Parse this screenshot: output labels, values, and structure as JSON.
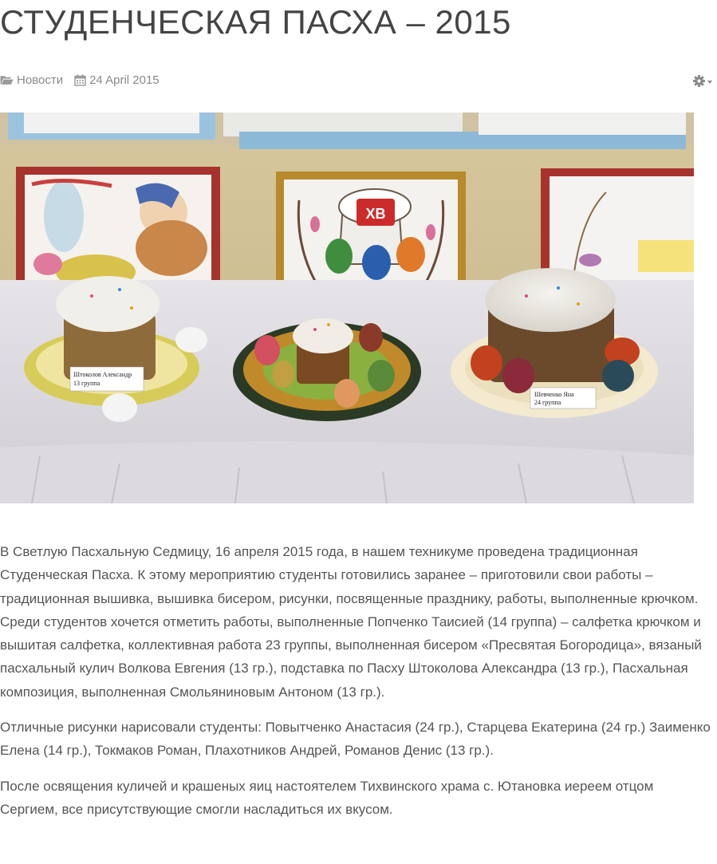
{
  "article": {
    "title": "СТУДЕНЧЕСКАЯ ПАСХА – 2015",
    "category": "Новости",
    "date": "24 April 2015",
    "paragraphs": [
      "В Светлую Пасхальную Седмицу, 16 апреля 2015 года, в нашем техникуме проведена традиционная Студенческая Пасха. К этому мероприятию студенты готовились заранее – приготовили свои работы – традиционная вышивка, вышивка бисером, рисунки, посвященные празднику, работы, выполненные крючком. Среди студентов хочется отметить работы, выполненные Попченко Таисией (14 группа) – салфетка крючком и вышитая салфетка, коллективная работа 23 группы, выполненная бисером «Пресвятая Богородица», вязаный пасхальный кулич Волкова Евгения (13 гр.), подставка по Пасху Штоколова Александра (13 гр.), Пасхальная композиция, выполненная Смольяниновым Антоном (13 гр.).",
      "Отличные рисунки нарисовали студенты: Повытченко Анастасия (24 гр.), Старцева Екатерина (24 гр.) Заименко Елена (14 гр.), Токмаков Роман, Плахотников Андрей, Романов Денис (13 гр.).",
      "После освящения куличей и крашеных яиц настоятелем Тихвинского храма с. Ютановка иереем отцом Сергием, все присутствующие смогли насладиться их вкусом."
    ]
  },
  "photo": {
    "painting_text": "ХВ",
    "label_left_name": "Штоколов Александр",
    "label_left_group": "13 группа",
    "label_right_name": "Шевченко Яна",
    "label_right_group": "24 группа"
  },
  "icons": {
    "category": "folder-open-icon",
    "date": "calendar-icon",
    "tools": "gear-icon"
  },
  "colors": {
    "title": "#444444",
    "meta": "#8a8a8a",
    "text": "#555555"
  }
}
